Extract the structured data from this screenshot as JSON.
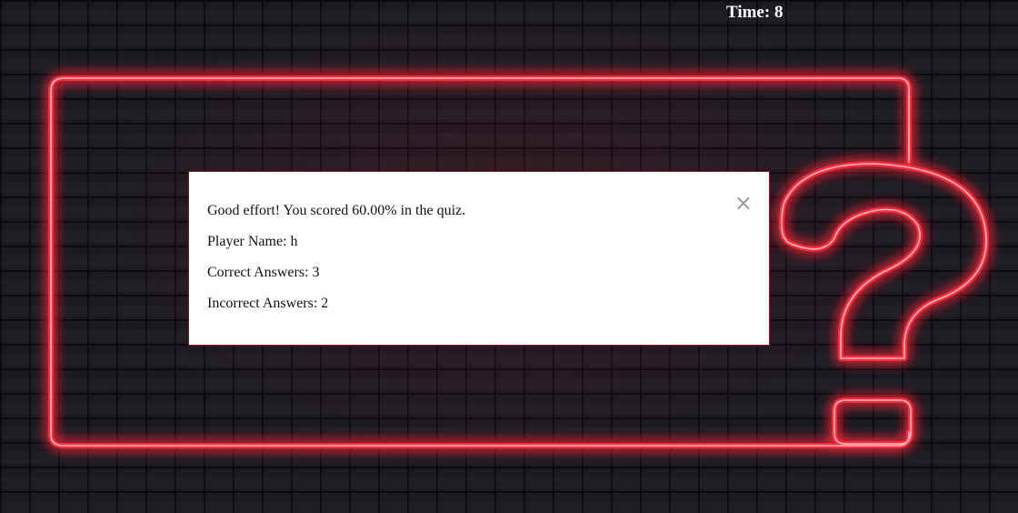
{
  "timer": {
    "text": "Time: 8"
  },
  "result_modal": {
    "close_glyph": "×",
    "message": "Good effort! You scored 60.00% in the quiz.",
    "player_name": "Player Name: h",
    "correct_answers": "Correct Answers: 3",
    "incorrect_answers": "Incorrect Answers: 2"
  },
  "background": {
    "theme": "neon-question-frame-on-brick-wall",
    "neon_color": "#ff2a3a",
    "wall_color": "#1c1b22"
  }
}
